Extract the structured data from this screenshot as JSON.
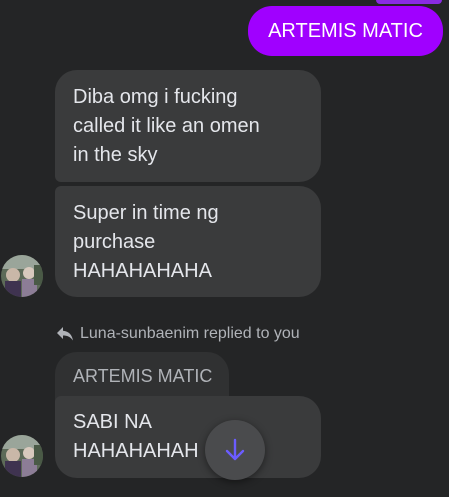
{
  "messages": {
    "sent_1": "ARTEMIS MATIC",
    "received_1": "Diba omg i fucking\ncalled it like an omen\nin the sky",
    "received_2": "Super in time ng\npurchase\nHAHAHAHAHA",
    "reply_label": "Luna-sunbaenim replied to you",
    "quoted_text": "ARTEMIS MATIC",
    "received_3": "SABI NA\nHAHAHAHAH"
  },
  "colors": {
    "background": "#242526",
    "sent_bubble": "#a000ff",
    "received_bubble": "#3a3b3c",
    "quoted_bubble": "#303132",
    "scroll_arrow": "#6b5cff"
  },
  "icons": {
    "reply": "reply-arrow-icon",
    "scroll_down": "arrow-down-icon",
    "avatar": "contact-avatar"
  }
}
